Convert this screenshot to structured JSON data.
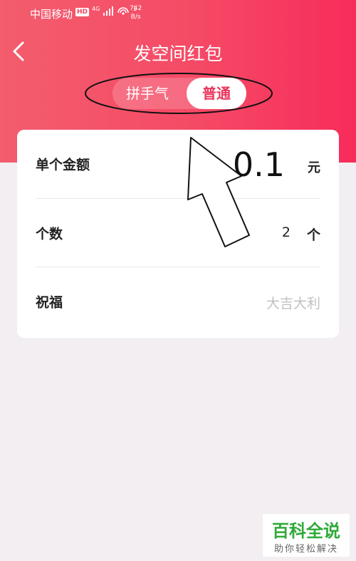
{
  "status_bar": {
    "carrier": "中国移动",
    "hd_badge": "HD",
    "network": "4G",
    "signal_extra": "1",
    "speed_value": "742",
    "speed_unit": "B/s"
  },
  "header": {
    "title": "发空间红包",
    "background_colors": [
      "#f35d6d",
      "#f72c5a"
    ]
  },
  "tabs": [
    {
      "label": "拼手气",
      "selected": false
    },
    {
      "label": "普通",
      "selected": true
    }
  ],
  "form": {
    "amount": {
      "label": "单个金额",
      "value": "0.1",
      "unit": "元"
    },
    "count": {
      "label": "个数",
      "value": "2",
      "unit": "个"
    },
    "blessing": {
      "label": "祝福",
      "placeholder": "大吉大利"
    }
  },
  "watermark": {
    "title": "百科全说",
    "subtitle": "助你轻松解决"
  },
  "accent_color": "#e9355b"
}
